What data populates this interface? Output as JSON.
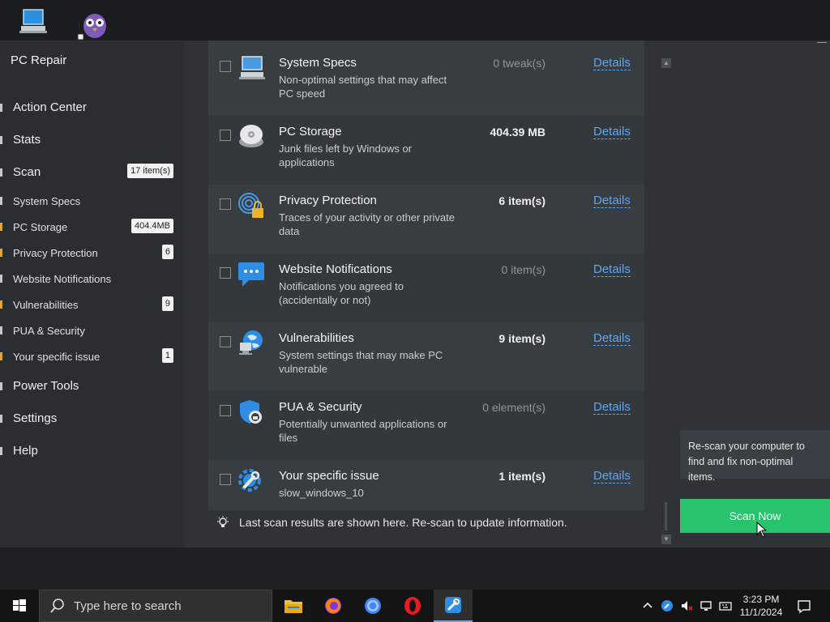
{
  "app": {
    "title": "PC Repair"
  },
  "sidebar": {
    "main_items": [
      {
        "label": "Action Center"
      },
      {
        "label": "Stats"
      },
      {
        "label": "Scan",
        "badge": "17 item(s)"
      },
      {
        "label": "Power Tools"
      },
      {
        "label": "Settings"
      },
      {
        "label": "Help"
      }
    ],
    "sub_items": [
      {
        "label": "System Specs"
      },
      {
        "label": "PC Storage",
        "badge": "404.4MB"
      },
      {
        "label": "Privacy Protection",
        "badge": "6"
      },
      {
        "label": "Website Notifications"
      },
      {
        "label": "Vulnerabilities",
        "badge": "9"
      },
      {
        "label": "PUA & Security"
      },
      {
        "label": "Your specific issue",
        "badge": "1"
      }
    ]
  },
  "results": [
    {
      "title": "System Specs",
      "desc": "Non-optimal settings that may affect PC speed",
      "value": "0 tweak(s)",
      "details": "Details",
      "icon": "computer-icon"
    },
    {
      "title": "PC Storage",
      "desc": "Junk files left by Windows or applications",
      "value": "404.39 MB",
      "details": "Details",
      "icon": "disk-icon"
    },
    {
      "title": "Privacy Protection",
      "desc": "Traces of your activity or other private data",
      "value": "6 item(s)",
      "details": "Details",
      "icon": "fingerprint-lock-icon"
    },
    {
      "title": "Website Notifications",
      "desc": "Notifications you agreed to (accidentally or not)",
      "value": "0 item(s)",
      "details": "Details",
      "icon": "chat-bubble-icon"
    },
    {
      "title": "Vulnerabilities",
      "desc": "System settings that may make PC vulnerable",
      "value": "9 item(s)",
      "details": "Details",
      "icon": "globe-icon"
    },
    {
      "title": "PUA & Security",
      "desc": "Potentially unwanted applications or files",
      "value": "0 element(s)",
      "details": "Details",
      "icon": "shield-icon"
    },
    {
      "title": "Your specific issue",
      "desc": "slow_windows_10",
      "value": "1 item(s)",
      "details": "Details",
      "icon": "wrench-gear-icon"
    }
  ],
  "footer_note": "Last scan results are shown here. Re-scan to update information.",
  "rescan_hint": "Re-scan your computer to find and fix non-optimal items.",
  "scan_button": "Scan Now",
  "taskbar": {
    "search_placeholder": "Type here to search",
    "time": "3:23 PM",
    "date": "11/1/2024"
  },
  "colors": {
    "accent_green": "#27c36d",
    "link_blue": "#5fa8f0",
    "badge_bg": "#f2f2f2"
  }
}
